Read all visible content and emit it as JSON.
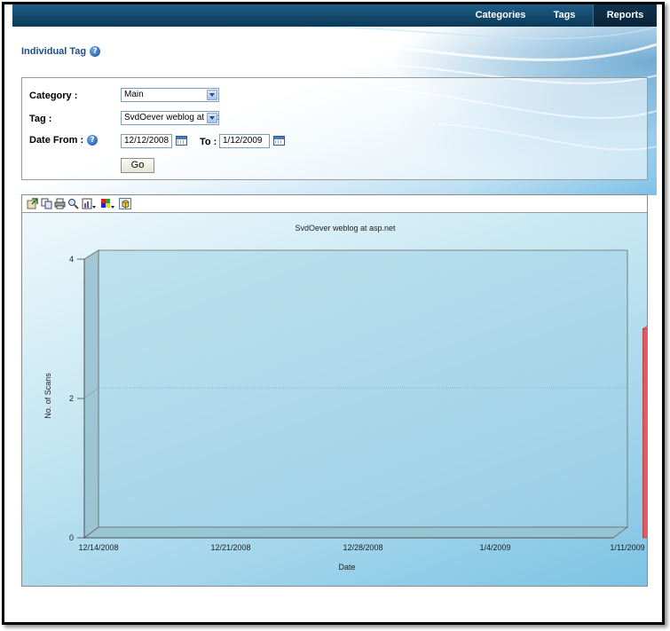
{
  "nav": {
    "tabs": [
      {
        "label": "Categories"
      },
      {
        "label": "Tags"
      },
      {
        "label": "Reports"
      }
    ],
    "active": "Reports"
  },
  "page": {
    "title": "Individual Tag"
  },
  "filter": {
    "category_label": "Category :",
    "category_value": "Main",
    "tag_label": "Tag :",
    "tag_value": "SvdOever weblog at asp",
    "date_from_label": "Date From :",
    "date_from_value": "12/12/2008",
    "to_label": "To :",
    "date_to_value": "1/12/2009",
    "go_label": "Go"
  },
  "toolbar": {
    "icons": [
      "export-icon",
      "copy-icon",
      "print-icon",
      "zoom-icon",
      "chart-type-icon",
      "palette-icon",
      "3d-toggle-icon"
    ]
  },
  "chart_data": {
    "type": "bar",
    "title": "SvdOever weblog at asp.net",
    "xlabel": "Date",
    "ylabel": "No. of Scans",
    "x_ticks": [
      "12/14/2008",
      "12/21/2008",
      "12/28/2008",
      "1/4/2009",
      "1/11/2009"
    ],
    "y_ticks": [
      "0",
      "2",
      "4"
    ],
    "ylim": [
      0,
      4
    ],
    "grid": true,
    "style": "3d",
    "bar_color": "#e05a64",
    "bars": [
      {
        "x": "1/12/2009",
        "value": 3
      }
    ]
  }
}
